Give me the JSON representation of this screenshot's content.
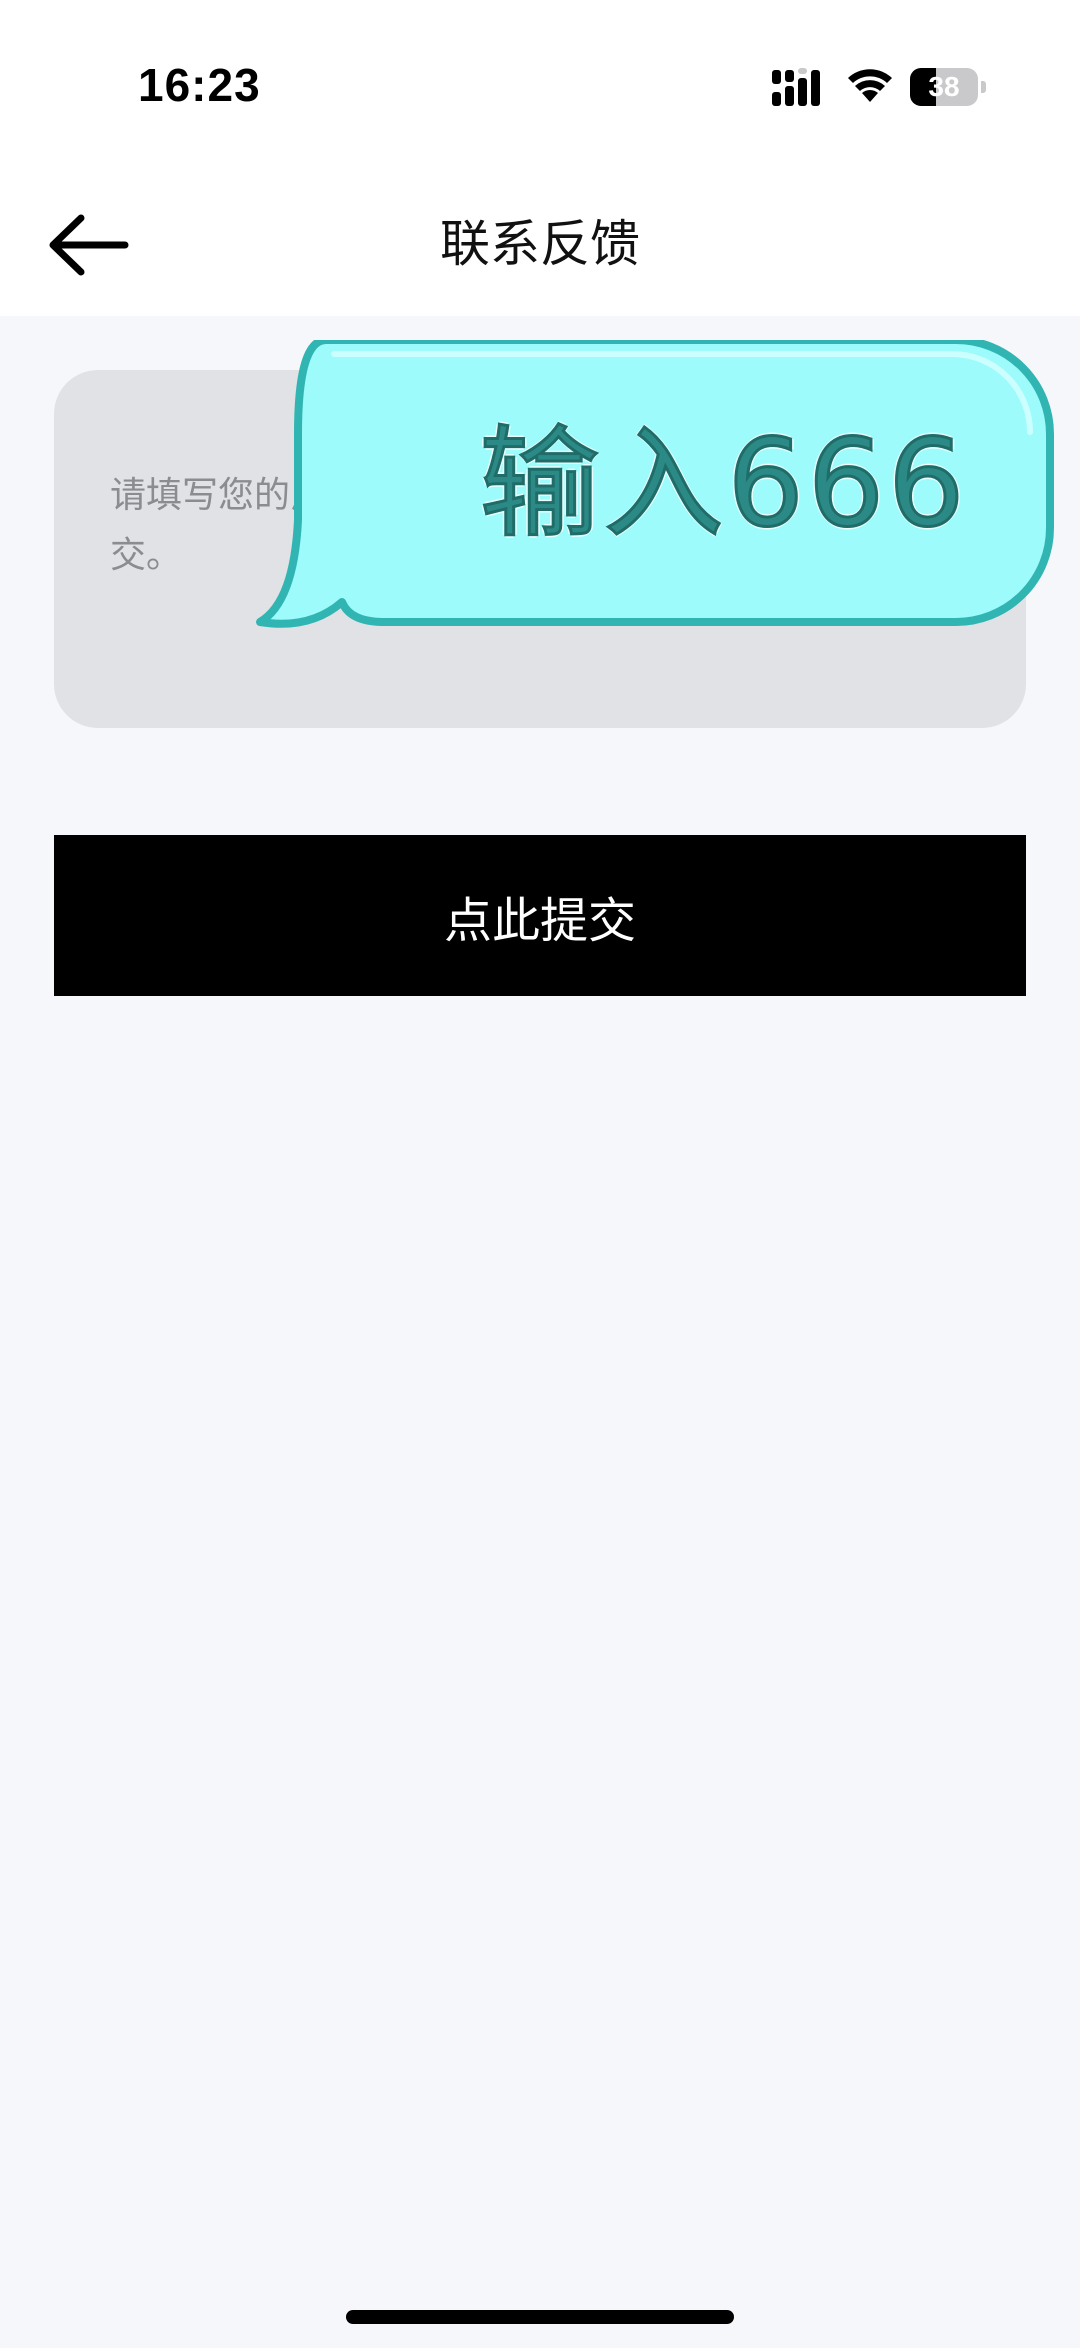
{
  "status_bar": {
    "time": "16:23",
    "battery_level": "38",
    "battery_fraction": 0.38,
    "icons": [
      "signal-icon",
      "wifi-icon",
      "battery-icon"
    ]
  },
  "header": {
    "back_icon": "arrow-left-icon",
    "title": "联系反馈"
  },
  "feedback": {
    "placeholder": "请填写您的反馈内容，填写完成后点击下方按钮提交。",
    "value": ""
  },
  "submit": {
    "label": "点此提交"
  },
  "overlay": {
    "text": "输入666"
  },
  "colors": {
    "page_background": "#f6f7fb",
    "header_background": "#ffffff",
    "input_background": "#e1e2e6",
    "button_background": "#000000",
    "button_text": "#ffffff",
    "overlay_fill": "#9dfbfb",
    "overlay_border": "#31b5b3",
    "overlay_text": "#2b8a86"
  }
}
